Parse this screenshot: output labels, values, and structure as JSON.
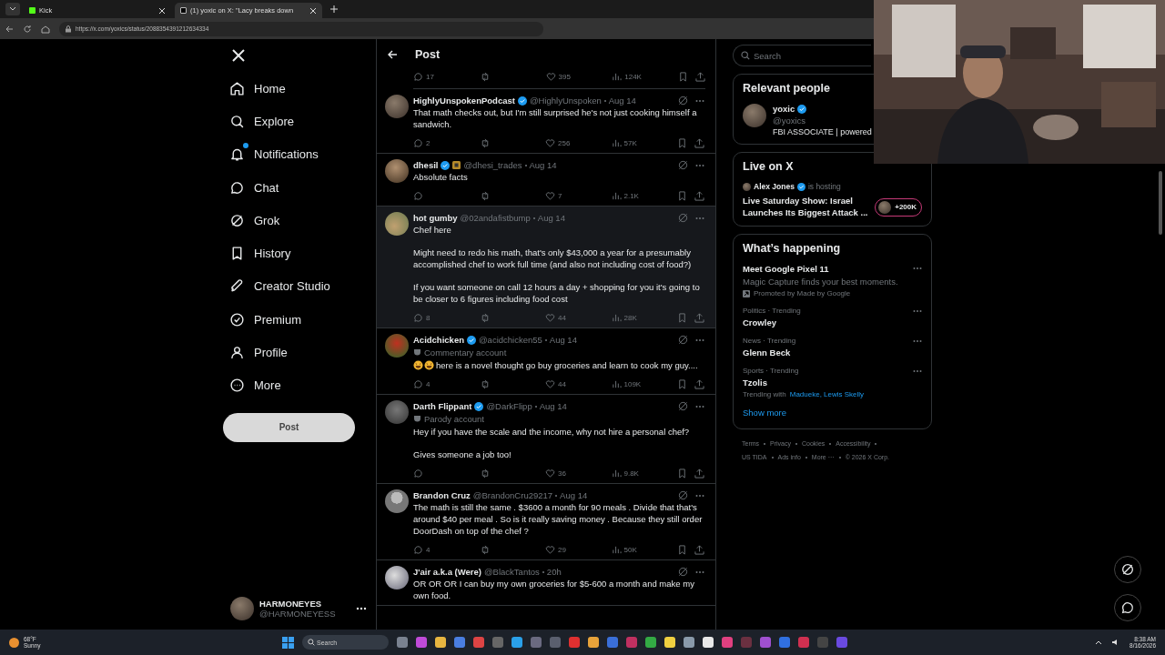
{
  "browser": {
    "tabs": [
      {
        "title": "Kick",
        "selected": false
      },
      {
        "title": "(1) yoxic on X: \"Lacy breaks down",
        "selected": true
      }
    ],
    "address": "https://x.com/yoxics/status/2088354391212634334"
  },
  "nav": {
    "items": [
      {
        "label": "Home",
        "unread": false
      },
      {
        "label": "Explore",
        "unread": false
      },
      {
        "label": "Notifications",
        "unread": true
      },
      {
        "label": "Chat",
        "unread": false
      },
      {
        "label": "Grok",
        "unread": false
      },
      {
        "label": "History",
        "unread": false
      },
      {
        "label": "Creator Studio",
        "unread": false
      },
      {
        "label": "Premium",
        "unread": false
      },
      {
        "label": "Profile",
        "unread": false
      },
      {
        "label": "More",
        "unread": false
      }
    ],
    "post_button": "Post",
    "account": {
      "name": "HARMONEYES",
      "handle": "@HARMONEYESS"
    }
  },
  "feed": {
    "title": "Post",
    "top_actions": {
      "replies": "17",
      "likes": "395",
      "views": "124K"
    },
    "posts": [
      {
        "name": "HighlyUnspokenPodcast",
        "verified": true,
        "affiliate": false,
        "handle": "@HighlyUnspoken",
        "date": "Aug 14",
        "emoji_lead": false,
        "highlighted": false,
        "body": [
          "That math checks out, but I'm still surprised he's not just cooking himself a sandwich."
        ],
        "replies": "2",
        "likes": "256",
        "views": "57K"
      },
      {
        "name": "dhesil",
        "verified": true,
        "affiliate": true,
        "handle": "@dhesi_trades",
        "date": "Aug 14",
        "emoji_lead": false,
        "highlighted": false,
        "body": [
          "Absolute facts"
        ],
        "likes": "7",
        "views": "2.1K"
      },
      {
        "name": "hot gumby",
        "verified": false,
        "affiliate": false,
        "handle": "@02andafistbump",
        "date": "Aug 14",
        "emoji_lead": false,
        "highlighted": true,
        "body": [
          "Chef here",
          "Might need to redo his math, that's only $43,000 a year for a presumably accomplished chef to work full time (and also not including cost of food?)",
          "If you want someone on call 12 hours a day + shopping for you it's going to be closer to 6 figures including food cost"
        ],
        "replies": "8",
        "likes": "44",
        "views": "28K"
      },
      {
        "name": "Acidchicken",
        "verified": true,
        "affiliate": false,
        "handle": "@acidchicken55",
        "date": "Aug 14",
        "label": "Commentary account",
        "emoji_lead": true,
        "highlighted": false,
        "body": [
          "here is a novel thought go buy groceries and learn to cook my guy...."
        ],
        "replies": "4",
        "likes": "44",
        "views": "109K"
      },
      {
        "name": "Darth Flippant",
        "verified": true,
        "affiliate": false,
        "handle": "@DarkFlipp",
        "date": "Aug 14",
        "label": "Parody account",
        "emoji_lead": false,
        "highlighted": false,
        "body": [
          "Hey if you have the scale and the income, why not hire a personal chef?",
          "Gives someone a job too!"
        ],
        "likes": "36",
        "views": "9.8K"
      },
      {
        "name": "Brandon Cruz",
        "verified": false,
        "affiliate": false,
        "handle": "@BrandonCru29217",
        "date": "Aug 14",
        "emoji_lead": false,
        "highlighted": false,
        "body": [
          "The math is still the same . $3600 a month for 90 meals . Divide that that's around $40 per meal . So is it really saving money . Because they still order DoorDash on top of the chef ?"
        ],
        "replies": "4",
        "likes": "29",
        "views": "50K"
      },
      {
        "name": "J'air a.k.a (Were)",
        "verified": false,
        "affiliate": false,
        "handle": "@BlackTantos",
        "date": "20h",
        "emoji_lead": false,
        "highlighted": false,
        "body": [
          "OR OR OR I can buy my own groceries for $5-600 a month and make my own food."
        ]
      }
    ]
  },
  "sidebar": {
    "search": {
      "placeholder": "Search"
    },
    "relevant": {
      "title": "Relevant people",
      "people": [
        {
          "name": "yoxic",
          "verified": true,
          "handle": "@yoxics",
          "bio": "FBI ASSOCIATE | powered"
        }
      ]
    },
    "live": {
      "title": "Live on X",
      "host": "Alex Jones",
      "host_verified": true,
      "host_note": "is hosting",
      "show": "Live Saturday Show: Israel Launches Its Biggest Attack ...",
      "listeners": "+200K"
    },
    "happening": {
      "title": "What’s happening",
      "items": [
        {
          "kind": "promoted",
          "title": "Meet Google Pixel 11",
          "desc": "Magic Capture finds your best moments.",
          "promoted": "Promoted by Made by Google"
        },
        {
          "kind": "trend",
          "context": "Politics · Trending",
          "title": "Crowley"
        },
        {
          "kind": "trend",
          "context": "News · Trending",
          "title": "Glenn Beck"
        },
        {
          "kind": "trend",
          "context": "Sports · Trending",
          "title": "Tzolis",
          "trending_with": "Trending with",
          "related": "Madueke, Lewis Skelly"
        }
      ],
      "show_more": "Show more"
    },
    "footer": [
      "Terms",
      "Privacy",
      "Cookies",
      "Accessibility",
      "US TIDA",
      "Ads info",
      "More ···",
      "© 2026 X Corp."
    ]
  },
  "taskbar": {
    "temp": "68°F",
    "weather": "Sunny",
    "search": {
      "placeholder": "Search"
    },
    "time": "8:38 AM",
    "date": "8/16/2026"
  }
}
